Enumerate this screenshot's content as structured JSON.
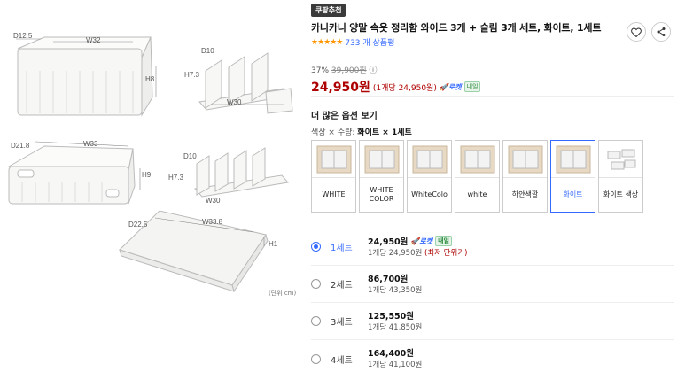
{
  "product_image": {
    "labels": {
      "d12_5": "D12.5",
      "w32": "W32",
      "h8": "H8",
      "d10_top": "D10",
      "h7_3_top": "H7.3",
      "w30_top": "W30",
      "d21_8": "D21.8",
      "w33": "W33",
      "h9": "H9",
      "d10_mid": "D10",
      "h7_3_mid": "H7.3",
      "w30_mid": "W30",
      "d22_5": "D22.5",
      "w33_8": "W33.8",
      "h1": "H1"
    },
    "unit_note": "(단위 cm)"
  },
  "badge": "쿠팡추천",
  "title": "카니카니 양말 속옷 정리함 와이드 3개 + 슬림 3개 세트, 화이트, 1세트",
  "rating": {
    "stars": "★★★★★",
    "count_text": "733 개 상품평"
  },
  "price": {
    "discount": "37%",
    "original": "39,900원",
    "info_icon": "ⓘ",
    "sale": "24,950원",
    "unit": "(1개당 24,950원)",
    "rocket": "로켓",
    "naeil": "내일"
  },
  "more_options": "더 많은 옵션 보기",
  "selection": {
    "prefix": "색상 × 수량:",
    "value": "화이트 × 1세트"
  },
  "swatches": [
    {
      "label": "WHITE"
    },
    {
      "label": "WHITE COLOR"
    },
    {
      "label": "WhiteColo"
    },
    {
      "label": "white"
    },
    {
      "label": "하얀색깔"
    },
    {
      "label": "화이트"
    },
    {
      "label": "화이트 색상"
    }
  ],
  "sets": [
    {
      "name": "1세트",
      "price": "24,950원",
      "unit": "1개당 24,950원",
      "best": "(최저 단위가)",
      "rocket": "로켓",
      "naeil": "내일"
    },
    {
      "name": "2세트",
      "price": "86,700원",
      "unit": "1개당 43,350원"
    },
    {
      "name": "3세트",
      "price": "125,550원",
      "unit": "1개당 41,850원"
    },
    {
      "name": "4세트",
      "price": "164,400원",
      "unit": "1개당 41,100원"
    }
  ],
  "colors": {
    "accent": "#346aff",
    "price_red": "#ae0000",
    "star": "#ff9600"
  }
}
